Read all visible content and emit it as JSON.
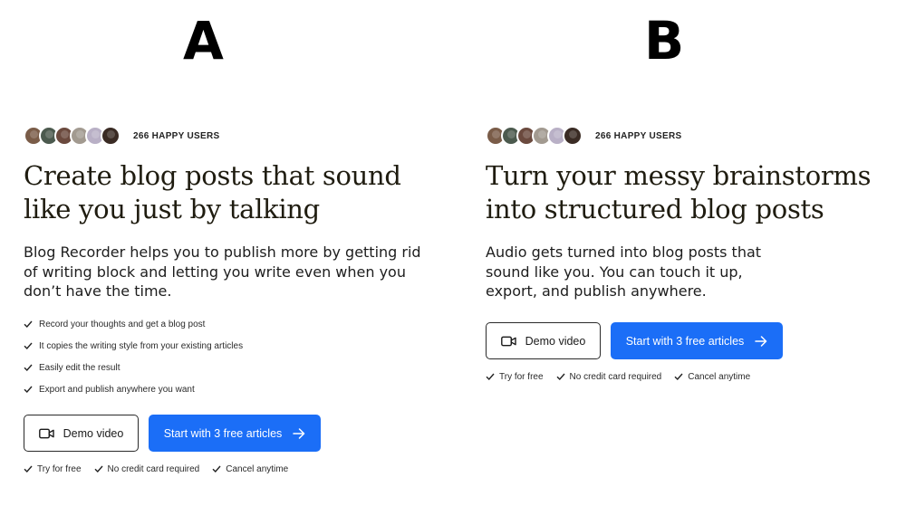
{
  "colors": {
    "primary_button": "#1b6ef7",
    "headline_text": "#1f1c10",
    "background": "#ffffff"
  },
  "avatars": [
    {
      "color": "#7a5c48",
      "icon": "user-avatar"
    },
    {
      "color": "#4c5a4e",
      "icon": "user-avatar"
    },
    {
      "color": "#6b4a3e",
      "icon": "user-avatar"
    },
    {
      "color": "#a29a90",
      "icon": "user-avatar"
    },
    {
      "color": "#b9b0c6",
      "icon": "user-avatar"
    },
    {
      "color": "#3a2b24",
      "icon": "user-avatar"
    }
  ],
  "variant_a": {
    "label": "A",
    "users_count": "266 HAPPY USERS",
    "headline": "Create blog posts that sound like you just by talking",
    "lead": "Blog Recorder helps you to publish more by getting rid of writing block and letting you write even when you don’t have the time.",
    "features": [
      "Record your thoughts and get a blog post",
      "It copies the writing style from your existing articles",
      "Easily edit the result",
      "Export and publish anywhere you want"
    ],
    "demo_button": "Demo video",
    "cta_button": "Start with 3 free articles",
    "guarantees": [
      "Try for free",
      "No credit card required",
      "Cancel anytime"
    ]
  },
  "variant_b": {
    "label": "B",
    "users_count": "266 HAPPY USERS",
    "headline": "Turn your messy brainstorms into structured blog posts",
    "lead": "Audio gets turned into blog posts that sound like you. You can touch it up, export, and publish anywhere.",
    "demo_button": "Demo video",
    "cta_button": "Start with 3 free articles",
    "guarantees": [
      "Try for free",
      "No credit card required",
      "Cancel anytime"
    ]
  }
}
